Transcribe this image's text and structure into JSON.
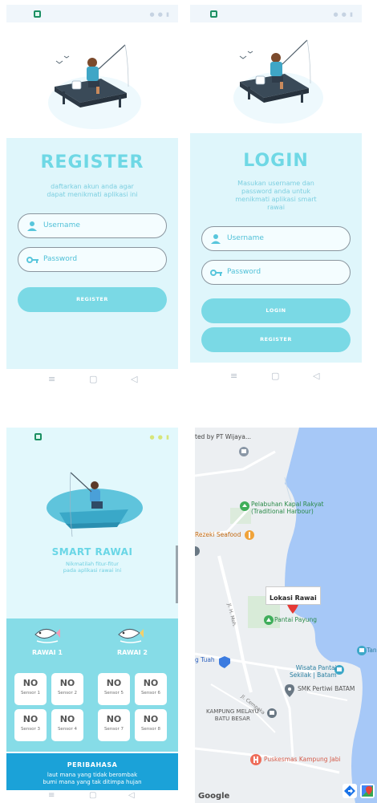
{
  "register_screen": {
    "title": "REGISTER",
    "subtitle_line1": "daftarkan akun anda agar",
    "subtitle_line2": "dapat menikmati aplikasi ini",
    "username_placeholder": "Username",
    "password_placeholder": "Password",
    "register_button": "REGISTER",
    "nav": {
      "recent": "≡",
      "home": "▢",
      "back": "◁"
    }
  },
  "login_screen": {
    "title": "LOGIN",
    "subtitle_line1": "Masukan username dan",
    "subtitle_line2": "password anda untuk",
    "subtitle_line3": "menikmati aplikasi smart",
    "subtitle_line4": "rawai",
    "username_placeholder": "Username",
    "password_placeholder": "Password",
    "login_button": "LOGIN",
    "register_button": "REGISTER",
    "nav": {
      "recent": "≡",
      "home": "▢",
      "back": "◁"
    }
  },
  "dashboard_screen": {
    "title": "SMART RAWAI",
    "subtitle_line1": "Nikmatilah fitur-fitur",
    "subtitle_line2": "pada aplikasi rawai ini",
    "rawai1_label": "RAWAI 1",
    "rawai2_label": "RAWAI 2",
    "sensors": [
      {
        "value": "NO",
        "label": "Sensor 1"
      },
      {
        "value": "NO",
        "label": "Sensor 2"
      },
      {
        "value": "NO",
        "label": "Sensor 3"
      },
      {
        "value": "NO",
        "label": "Sensor 4"
      },
      {
        "value": "NO",
        "label": "Sensor 5"
      },
      {
        "value": "NO",
        "label": "Sensor 6"
      },
      {
        "value": "NO",
        "label": "Sensor 7"
      },
      {
        "value": "NO",
        "label": "Sensor 8"
      }
    ],
    "peribahasa_title": "PERIBAHASA",
    "peribahasa_line1": "laut mana yang tidak berombak",
    "peribahasa_line2": "bumi mana yang tak ditimpa hujan",
    "nav": {
      "recent": "≡",
      "home": "▢",
      "back": "◁"
    }
  },
  "map_screen": {
    "top_label": "ted by PT Wijaya...",
    "places": {
      "pelabuhan_line1": "Pelabuhan Kapal Rakyat",
      "pelabuhan_line2": "(Traditional Harbour)",
      "rezeki": "Rezeki Seafood",
      "lokasi_rawai": "Lokasi Rawai",
      "pantai_payung": "Pantai Payung",
      "road": "Jl. H. Moh.",
      "road2": "Jl. Cempaka",
      "tuah": "g Tuah",
      "wisata_line1": "Wisata Pantai",
      "wisata_line2": "Sekilak | Batam",
      "smk": "SMK Pertiwi BATAM",
      "kampung_line1": "KAMPUNG MELAYU",
      "kampung_line2": "BATU BESAR",
      "puskesmas": "Puskesmas Kampung Jabi",
      "tan": "Tan"
    },
    "google_logo": "Google"
  },
  "colors": {
    "accent": "#6fd8e5",
    "card_bg": "#dff6fb",
    "band": "#1ba2d8",
    "water": "#a6c8f7",
    "marker": "#e53935"
  }
}
